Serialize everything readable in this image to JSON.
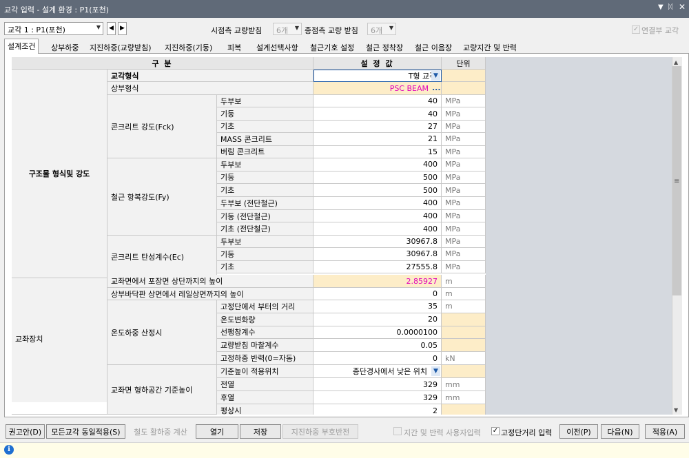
{
  "window": {
    "title": "교각 입력 - 설계 환경 : P1(포천)",
    "menu_icon": "chevron-down-icon",
    "pin_icon": "pin-icon",
    "close_icon": "close-icon"
  },
  "topbar": {
    "pier_select": "교각 1 : P1(포천)",
    "prev_icon": "left-arrow-icon",
    "next_icon": "right-arrow-icon",
    "start_bearing_label": "시점측 교량받침",
    "start_bearing_value": "6개",
    "end_bearing_label": "종점측 교량 받침",
    "end_bearing_value": "6개",
    "linked_pier_label": "연결부 교각",
    "linked_pier_checked": true
  },
  "tabs": [
    "설계조건",
    "상부하중",
    "지진하중(교량받침)",
    "지진하중(기둥)",
    "피복",
    "설계선택사항",
    "철근기호 설정",
    "철근 정착장",
    "철근 이음장",
    "교량지간 및 반력"
  ],
  "grid": {
    "headers": {
      "division": "구 분",
      "value": "설 정 값",
      "unit": "단위"
    },
    "group1": "구조물 형식및 강도",
    "group2": "교좌장치",
    "pier_type_label": "교각형식",
    "pier_type_value": "T형 교각",
    "super_type_label": "상부형식",
    "super_type_value": "PSC BEAM",
    "super_type_button": "...",
    "fck": {
      "label": "콘크리트 강도(Fck)",
      "rows": [
        {
          "name": "두부보",
          "value": "40",
          "unit": "MPa"
        },
        {
          "name": "기둥",
          "value": "40",
          "unit": "MPa"
        },
        {
          "name": "기초",
          "value": "27",
          "unit": "MPa"
        },
        {
          "name": "MASS 콘크리트",
          "value": "21",
          "unit": "MPa"
        },
        {
          "name": "버림 콘크리트",
          "value": "15",
          "unit": "MPa"
        }
      ]
    },
    "fy": {
      "label": "철근 항복강도(Fy)",
      "rows": [
        {
          "name": "두부보",
          "value": "400",
          "unit": "MPa"
        },
        {
          "name": "기둥",
          "value": "500",
          "unit": "MPa"
        },
        {
          "name": "기초",
          "value": "500",
          "unit": "MPa"
        },
        {
          "name": "두부보 (전단철근)",
          "value": "400",
          "unit": "MPa"
        },
        {
          "name": "기둥 (전단철근)",
          "value": "400",
          "unit": "MPa"
        },
        {
          "name": "기초 (전단철근)",
          "value": "400",
          "unit": "MPa"
        }
      ]
    },
    "ec": {
      "label": "콘크리트 탄성계수(Ec)",
      "rows": [
        {
          "name": "두부보",
          "value": "30967.8",
          "unit": "MPa"
        },
        {
          "name": "기둥",
          "value": "30967.8",
          "unit": "MPa"
        },
        {
          "name": "기초",
          "value": "27555.8",
          "unit": "MPa"
        }
      ]
    },
    "pave_label": "교좌면에서 포장면 상단까지의 높이",
    "pave_value": "2.85927",
    "pave_unit": "m",
    "rail_label": "상부바닥판 상면에서 레일상면까지의 높이",
    "rail_value": "0",
    "rail_unit": "m",
    "temp": {
      "label": "온도하중 산정시",
      "rows": [
        {
          "name": "고정단에서 부터의 거리",
          "value": "35",
          "unit": "m"
        },
        {
          "name": "온도변화량",
          "value": "20",
          "unit": ""
        },
        {
          "name": "선팽창계수",
          "value": "0.0000100",
          "unit": ""
        },
        {
          "name": "교량받침 마찰계수",
          "value": "0.05",
          "unit": ""
        },
        {
          "name": "고정하중 반력(0=자동)",
          "value": "0",
          "unit": "kN"
        }
      ]
    },
    "bearing_h": {
      "label": "교좌면 형하공간 기준높이",
      "rows": [
        {
          "name": "기준높이 적용위치",
          "value": "종단경사에서 낮은 위치",
          "unit": ""
        },
        {
          "name": "전열",
          "value": "329",
          "unit": "mm"
        },
        {
          "name": "후열",
          "value": "329",
          "unit": "mm"
        },
        {
          "name": "평상시",
          "value": "2",
          "unit": ""
        }
      ]
    }
  },
  "bottombar": {
    "recommend": "권고안(D)",
    "apply_all": "모든교각 동일적용(S)",
    "rail_brake": "철도 활하중 계산",
    "open": "열기",
    "save": "저장",
    "seismic_sign": "지진하중 부호반전",
    "span_user_label": "지간 및 반력 사용자입력",
    "span_user_checked": false,
    "fixed_dist_label": "고정단거리 입력",
    "fixed_dist_checked": true,
    "prev": "이전(P)",
    "next": "다음(N)",
    "apply": "적용(A)"
  },
  "status": {
    "icon": "info-icon",
    "text": ""
  }
}
